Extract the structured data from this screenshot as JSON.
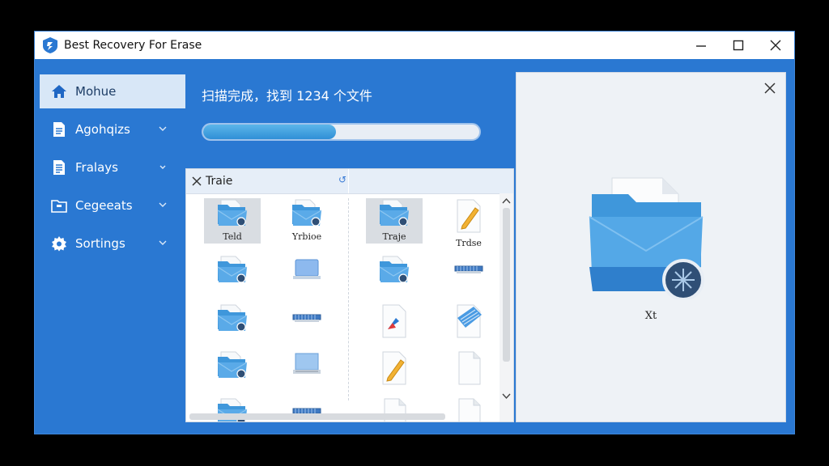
{
  "window": {
    "title": "Best Recovery For Erase"
  },
  "sidebar": {
    "items": [
      {
        "label": "Mohue",
        "icon": "home-icon",
        "active": true
      },
      {
        "label": "Agohqizs",
        "icon": "document-icon",
        "active": false
      },
      {
        "label": "Fralays",
        "icon": "document-list-icon",
        "active": false
      },
      {
        "label": "Cegeeats",
        "icon": "folder-icon",
        "active": false
      },
      {
        "label": "Sortings",
        "icon": "gear-icon",
        "active": false
      }
    ]
  },
  "scan": {
    "status_text": "扫描完成，找到 1234 个文件",
    "progress": 0.48
  },
  "files": {
    "header": "Traie",
    "items": [
      {
        "label": "Teld",
        "icon": "folder-icon",
        "selected": true
      },
      {
        "label": "Yrbioe",
        "icon": "folder-icon",
        "selected": false
      },
      {
        "label": "Traje",
        "icon": "folder-icon",
        "selected": true
      },
      {
        "label": "Trdse",
        "icon": "pencil-file-icon",
        "selected": false
      },
      {
        "label": "",
        "icon": "folder-icon"
      },
      {
        "label": "",
        "icon": "drive-icon"
      },
      {
        "label": "",
        "icon": "folder-icon"
      },
      {
        "label": "",
        "icon": "network-drive-icon"
      },
      {
        "label": "",
        "icon": "folder-icon"
      },
      {
        "label": "",
        "icon": "network-drive-icon"
      },
      {
        "label": "",
        "icon": "image-file-icon"
      },
      {
        "label": "",
        "icon": "blue-striped-file-icon"
      },
      {
        "label": "",
        "icon": "folder-icon"
      },
      {
        "label": "",
        "icon": "monitor-icon"
      },
      {
        "label": "",
        "icon": "pencil-file-icon"
      },
      {
        "label": "",
        "icon": "blank-file-icon"
      },
      {
        "label": "",
        "icon": "folder-icon"
      },
      {
        "label": "",
        "icon": "network-drive-icon"
      },
      {
        "label": "",
        "icon": "blank-file-icon"
      },
      {
        "label": "",
        "icon": "blank-file-icon"
      }
    ]
  },
  "preview": {
    "label": "Xt",
    "icon": "folder-document-icon"
  },
  "colors": {
    "accent": "#2a78d2",
    "sidebar_active": "#d8e7f7",
    "progress_fill": "#2f8fd6"
  }
}
